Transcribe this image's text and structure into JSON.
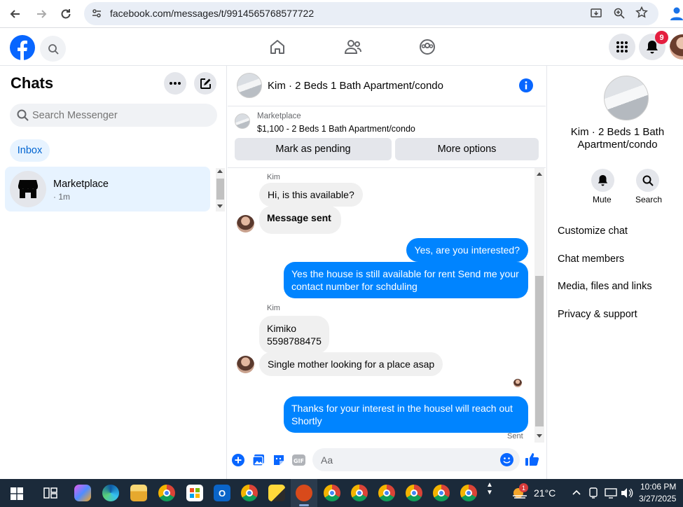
{
  "browser": {
    "url": "facebook.com/messages/t/9914565768577722"
  },
  "header": {
    "notification_count": "9"
  },
  "left": {
    "title": "Chats",
    "search_placeholder": "Search Messenger",
    "inbox_label": "Inbox",
    "chat_item": {
      "name": "Marketplace",
      "time": "· 1m"
    }
  },
  "conversation": {
    "title": "Kim · 2 Beds 1 Bath Apartment/condo",
    "listing_label": "Marketplace",
    "listing_desc": "$1,100 - 2 Beds 1 Bath Apartment/condo",
    "mark_pending": "Mark as pending",
    "more_options": "More options",
    "messages": [
      {
        "sender": "Kim"
      },
      {
        "text": "Hi, is this available?"
      },
      {
        "text": "Message sent"
      },
      {
        "text": "Yes, are you interested?"
      },
      {
        "text": "Yes the house is still available for rent Send me your contact number for schduling"
      },
      {
        "sender": "Kim"
      },
      {
        "text_line1": "Kimiko",
        "text_line2": "5598788475"
      },
      {
        "text": "Single mother looking for a place asap"
      },
      {
        "text": "Thanks for your interest in the housel will reach out Shortly"
      }
    ],
    "sent_status": "Sent",
    "composer_placeholder": "Aa"
  },
  "right": {
    "title": "Kim · 2 Beds 1 Bath Apartment/condo",
    "mute_label": "Mute",
    "search_label": "Search",
    "menu": [
      "Customize chat",
      "Chat members",
      "Media, files and links",
      "Privacy & support"
    ]
  },
  "taskbar": {
    "weather_badge": "1",
    "temperature": "21°C",
    "time": "10:06 PM",
    "date": "3/27/2025"
  },
  "colors": {
    "accent": "#0084ff",
    "fb_blue": "#0866ff",
    "taskbar": "#1b2a3a"
  }
}
